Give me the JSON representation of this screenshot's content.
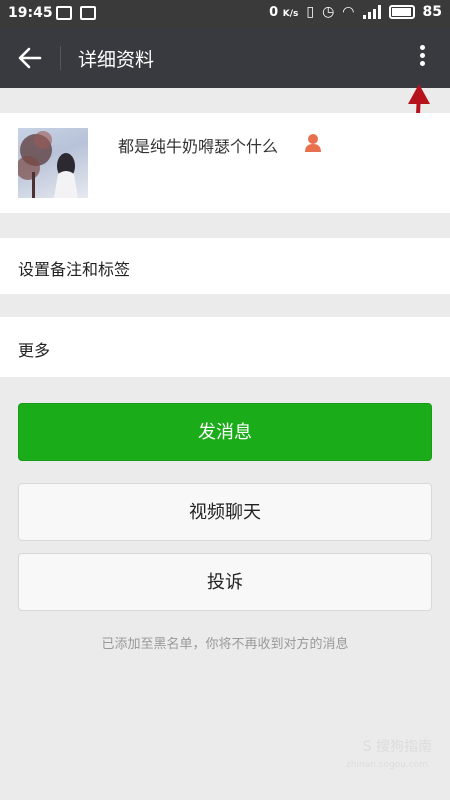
{
  "status_bar": {
    "time": "19:45",
    "net_speed": "0",
    "net_unit": "K/s",
    "battery": "85"
  },
  "header": {
    "title": "详细资料"
  },
  "profile": {
    "nickname": "都是纯牛奶嘚瑟个什么"
  },
  "rows": {
    "remark_label": "设置备注和标签",
    "more_label": "更多"
  },
  "buttons": {
    "send_message": "发消息",
    "video_chat": "视频聊天",
    "report": "投诉"
  },
  "note": "已添加至黑名单，你将不再收到对方的消息",
  "watermark": {
    "brand": "S 搜狗指南",
    "url": "zhinan.sogou.com"
  },
  "colors": {
    "header_bg": "#393a3f",
    "primary_green": "#1aad19",
    "annotation_red": "#b5121b"
  }
}
